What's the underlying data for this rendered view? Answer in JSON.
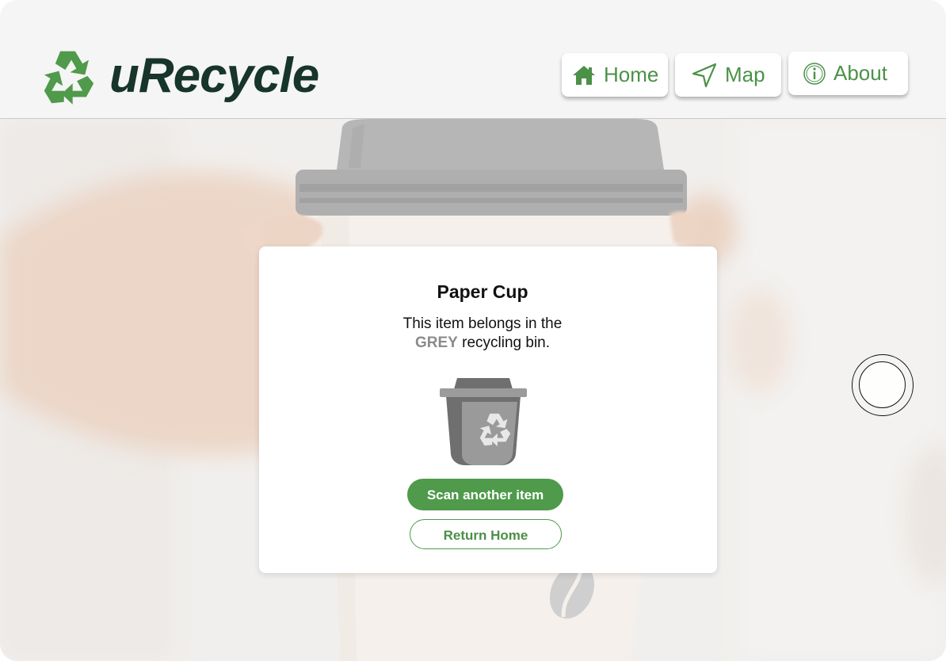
{
  "app": {
    "name": "uRecycle"
  },
  "nav": {
    "home_label": "Home",
    "map_label": "Map",
    "about_label": "About"
  },
  "result": {
    "item_name": "Paper Cup",
    "message_prefix": "This item belongs in the",
    "bin_color_name": "GREY",
    "message_suffix": "recycling bin.",
    "scan_button_label": "Scan another item",
    "home_button_label": "Return Home"
  },
  "colors": {
    "brand_green": "#4f9a4b",
    "brand_dark": "#17352a",
    "bin_grey": "#8b8b8b"
  },
  "icons": {
    "logo": "recycle-icon",
    "home": "house-icon",
    "map": "navigation-arrow-icon",
    "about": "info-icon",
    "bin": "grey-recycling-bin-icon"
  }
}
